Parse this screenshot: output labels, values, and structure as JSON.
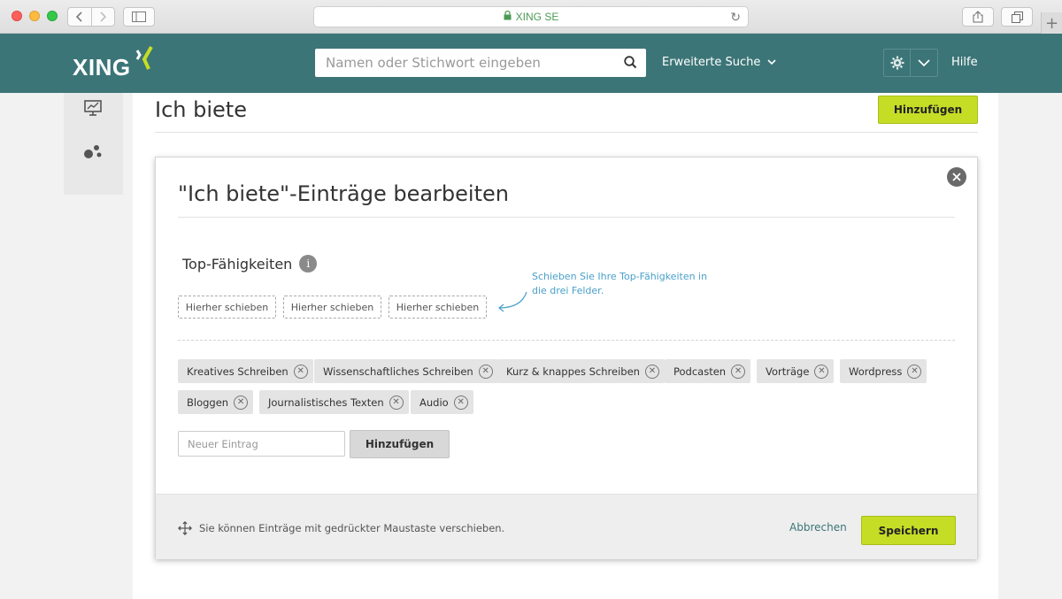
{
  "browser": {
    "address": "XING SE"
  },
  "header": {
    "logo_text": "XING",
    "search_placeholder": "Namen oder Stichwort eingeben",
    "advanced_search": "Erweiterte Suche",
    "help": "Hilfe",
    "brand_color": "#3c7577"
  },
  "page": {
    "title": "Ich biete",
    "add_button": "Hinzufügen"
  },
  "modal": {
    "title": "\"Ich biete\"-Einträge bearbeiten",
    "section_title": "Top-Fähigkeiten",
    "slots": [
      "Hierher schieben",
      "Hierher schieben",
      "Hierher schieben"
    ],
    "hint": "Schieben Sie Ihre Top-Fähigkeiten in die drei Felder.",
    "tags": [
      "Kreatives Schreiben",
      "Wissenschaftliches Schreiben",
      "Kurz & knappes Schreiben",
      "Podcasten",
      "Vorträge",
      "Wordpress",
      "Bloggen",
      "Journalistisches Texten",
      "Audio"
    ],
    "new_entry_placeholder": "Neuer Eintrag",
    "add_button": "Hinzufügen",
    "footer_hint": "Sie können Einträge mit gedrückter Maustaste verschieben.",
    "cancel": "Abbrechen",
    "save": "Speichern",
    "accent_color": "#c6dd26"
  }
}
